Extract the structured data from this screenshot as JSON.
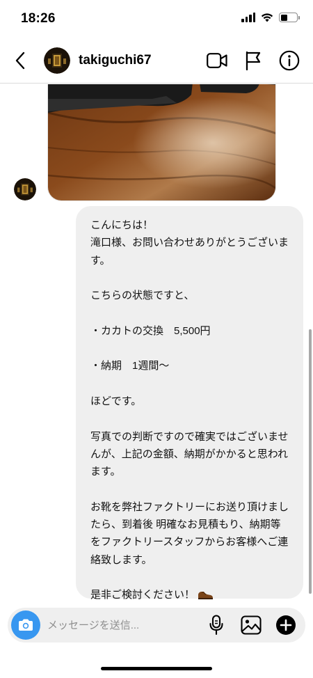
{
  "status_bar": {
    "time": "18:26"
  },
  "header": {
    "username": "takiguchi67"
  },
  "messages": [
    {
      "type": "image",
      "sender": "takiguchi67"
    },
    {
      "type": "text",
      "sender": "me",
      "text": "こんにちは！\n滝口様、お問い合わせありがとうございます。\n\nこちらの状態ですと、\n\n・カカトの交換　5,500円\n\n・納期　1週間〜\n\nほどです。\n\n写真での判断ですので確実ではございませんが、上記の金額、納期がかかると思われます。\n\nお靴を弊社ファクトリーにお送り頂けましたら、到着後 明確なお見積もり、納期等をファクトリースタッフからお客様へご連絡致します。\n\n是非ご検討ください！"
    }
  ],
  "composer": {
    "placeholder": "メッセージを送信..."
  },
  "icons": {
    "back": "chevron-left-icon",
    "video": "video-camera-icon",
    "flag": "flag-icon",
    "info": "info-icon",
    "camera": "camera-icon",
    "mic": "microphone-icon",
    "gallery": "gallery-icon",
    "add": "plus-circle-icon",
    "emoji": "shoe-emoji"
  },
  "colors": {
    "accent": "#3897f0",
    "bubble": "#efefef",
    "divider": "#dbdbdb"
  }
}
